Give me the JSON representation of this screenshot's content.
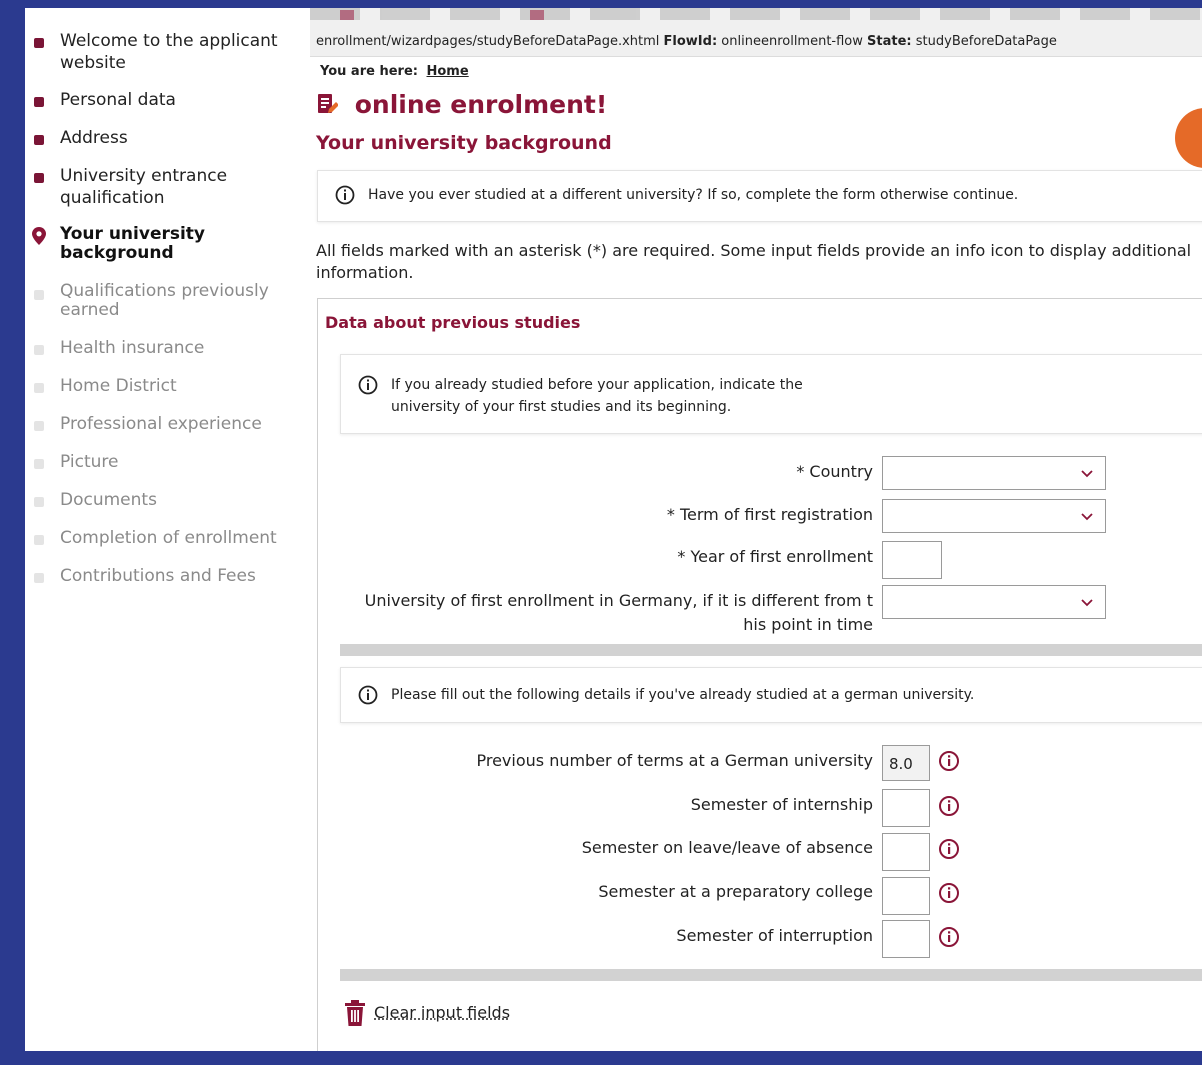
{
  "sidebar": {
    "items": [
      {
        "label": "Welcome to the applicant website"
      },
      {
        "label": "Personal data"
      },
      {
        "label": "Address"
      },
      {
        "label": "University entrance qualification"
      },
      {
        "label": "Your university background"
      },
      {
        "label": "Qualifications previously earned"
      },
      {
        "label": "Health insurance"
      },
      {
        "label": "Home District"
      },
      {
        "label": "Professional experience"
      },
      {
        "label": "Picture"
      },
      {
        "label": "Documents"
      },
      {
        "label": "Completion of enrollment"
      },
      {
        "label": "Contributions and Fees"
      }
    ]
  },
  "debug": {
    "path": "enrollment/wizardpages/studyBeforeDataPage.xhtml",
    "flow_label": "FlowId:",
    "flow_value": "onlineenrollment-flow",
    "state_label": "State:",
    "state_value": "studyBeforeDataPage"
  },
  "breadcrumb": {
    "prefix": "You are here:",
    "home": "Home"
  },
  "page": {
    "title": "online enrolment!",
    "section_title": "Your university background",
    "top_info": "Have you ever studied at a different university? If so, complete the form otherwise continue.",
    "required_note": "All fields marked with an asterisk (*) are required. Some input fields provide an info icon to display additional information."
  },
  "panel": {
    "title": "Data about previous studies",
    "info1": "If you already studied before your application, indicate the university of your first studies and its beginning.",
    "info2": "Please fill out the following details if you've already studied at a german university.",
    "fields": {
      "country_label": "* Country",
      "term_label": "* Term of first registration",
      "year_label": "* Year of first enrollment",
      "university_label_line1": "University of first enrollment in Germany, if it is different from t",
      "university_label_line2": "his point in time",
      "prev_terms_label": "Previous number of terms at a German university",
      "prev_terms_value": "8.0",
      "internship_label": "Semester of internship",
      "leave_label": "Semester on leave/leave of absence",
      "prep_label": "Semester at a preparatory college",
      "interruption_label": "Semester of interruption"
    },
    "clear_label": "Clear input fields"
  },
  "colors": {
    "accent": "#8a1538",
    "frame": "#2b3a8f",
    "orange": "#e56a28"
  }
}
